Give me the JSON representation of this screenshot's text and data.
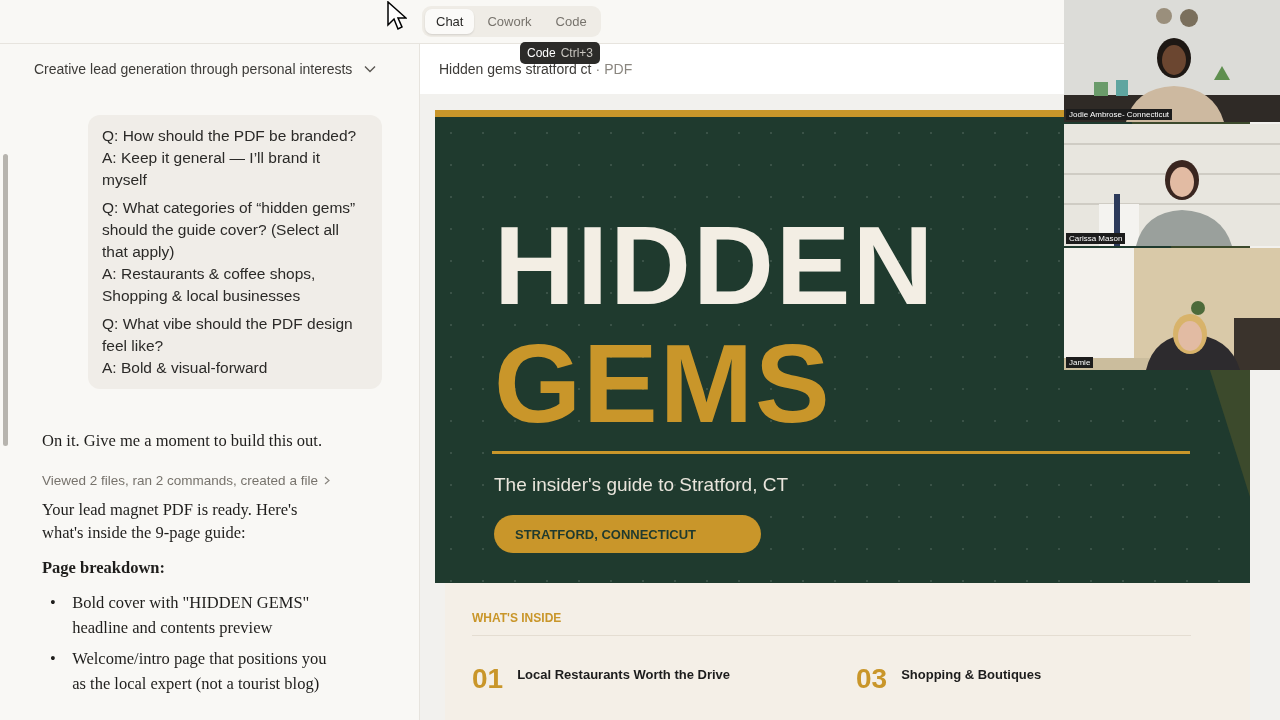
{
  "top_bar": {
    "mode_tabs": [
      {
        "label": "Chat",
        "selected": true
      },
      {
        "label": "Cowork",
        "selected": false
      },
      {
        "label": "Code",
        "selected": false
      }
    ],
    "tooltip": {
      "label": "Code",
      "shortcut": "Ctrl+3"
    }
  },
  "conversation": {
    "title": "Creative lead generation through personal interests",
    "user_message": [
      {
        "question": "Q: How should the PDF be branded?",
        "answer": "A: Keep it general — I’ll brand it myself"
      },
      {
        "question": "Q: What categories of “hidden gems” should the guide cover? (Select all that apply)",
        "answer": "A: Restaurants & coffee shops, Shopping & local businesses"
      },
      {
        "question": "Q: What vibe should the PDF design feel like?",
        "answer": "A: Bold & visual-forward"
      }
    ],
    "reply_intro": "On it. Give me a moment to build this out.",
    "tool_summary": "Viewed 2 files, ran 2 commands, created a file",
    "reply_text": "Your lead magnet PDF is ready. Here's what's inside the 9-page guide:",
    "section_heading": "Page breakdown:",
    "bullets": [
      {
        "marker": "•",
        "text": "Bold cover with \"HIDDEN GEMS\" headline and contents preview"
      },
      {
        "marker": "•",
        "text": "Welcome/intro page that positions you as the local expert (not a tourist blog)"
      }
    ]
  },
  "preview": {
    "file_name": "Hidden gems stratford ct",
    "file_type": "PDF",
    "separator": "·",
    "cover": {
      "headline_1": "HIDDEN",
      "headline_2": "GEMS",
      "tagline": "The insider's guide to Stratford, CT",
      "location_badge": "STRATFORD, CONNECTICUT"
    },
    "contents": {
      "heading": "WHAT'S INSIDE",
      "items": [
        {
          "number": "01",
          "title": "Local Restaurants Worth the Drive"
        },
        {
          "number": "03",
          "title": "Shopping & Boutiques"
        }
      ]
    }
  },
  "video_call": {
    "participants": [
      {
        "name": "Jodie Ambrose- Connecticut",
        "kind": "picture"
      },
      {
        "name": "Carissa Mason",
        "kind": "picture"
      },
      {
        "name": "Jamie",
        "kind": "picture"
      }
    ]
  }
}
